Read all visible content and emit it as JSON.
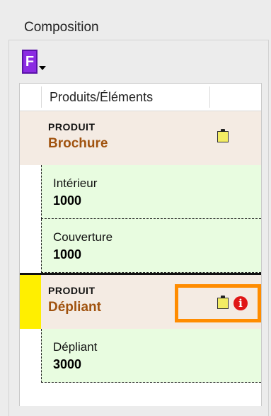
{
  "panel": {
    "title": "Composition"
  },
  "toolbar": {
    "button_glyph": "F",
    "button_icon": "format-menu-icon"
  },
  "table": {
    "column_header": "Produits/Éléments",
    "products": [
      {
        "kind": "PRODUIT",
        "name": "Brochure",
        "flag_color": "",
        "icons": [
          "clipboard-icon"
        ],
        "elements": [
          {
            "name": "Intérieur",
            "quantity": "1000"
          },
          {
            "name": "Couverture",
            "quantity": "1000"
          }
        ]
      },
      {
        "kind": "PRODUIT",
        "name": "Dépliant",
        "flag_color": "#ffef00",
        "icons": [
          "clipboard-icon",
          "info-icon"
        ],
        "info_glyph": "i",
        "elements": [
          {
            "name": "Dépliant",
            "quantity": "3000"
          }
        ]
      }
    ]
  },
  "colors": {
    "product_bg": "#f4ebe3",
    "product_name": "#a0520e",
    "element_bg": "#e8fce0",
    "highlight": "#ff8c00",
    "info": "#e01616"
  }
}
